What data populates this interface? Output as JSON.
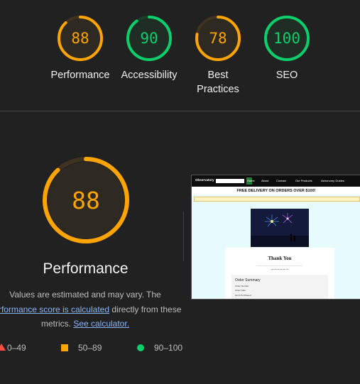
{
  "gauges": [
    {
      "label": "Performance",
      "score": "88",
      "value": 88,
      "color": "#ffa400",
      "track": "#3f3220",
      "fill": "#2e2a21"
    },
    {
      "label": "Accessibility",
      "score": "90",
      "value": 90,
      "color": "#0cce6b",
      "track": "#1b3d2a",
      "fill": "#1f2d24"
    },
    {
      "label": "Best Practices",
      "score": "78",
      "value": 78,
      "color": "#ffa400",
      "track": "#3f3220",
      "fill": "#2e2a21"
    },
    {
      "label": "SEO",
      "score": "100",
      "value": 100,
      "color": "#0cce6b",
      "track": "#1b3d2a",
      "fill": "#1f2d24"
    }
  ],
  "performance": {
    "score": "88",
    "value": 88,
    "title": "Performance",
    "desc_before": "Values are estimated and may vary. The",
    "desc_link": "performance score is calculated",
    "desc_middle": " directly from these",
    "desc_after": "metrics.",
    "calc_link": "See calculator."
  },
  "legend": {
    "fail": "0–49",
    "average": "50–89",
    "pass": "90–100"
  },
  "screenshot": {
    "brand": "Observatory",
    "nav": [
      "Home",
      "About",
      "Contact",
      "Our Products",
      "Astronomy Guides"
    ],
    "promo": "FREE DELIVERY ON ORDERS OVER $100!",
    "thank_title": "Thank You",
    "summary_title": "Order Summary",
    "summary_lines": [
      "Order Number:",
      "Order Date:",
      "Items Purchased:"
    ]
  }
}
